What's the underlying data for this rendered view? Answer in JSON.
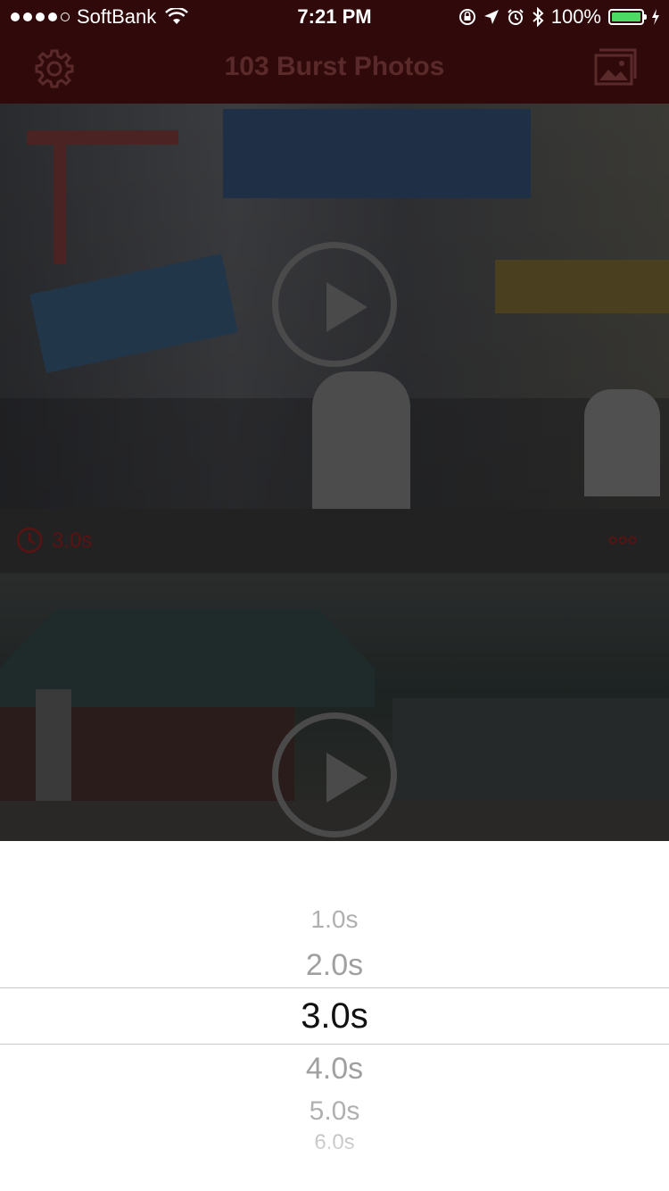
{
  "status_bar": {
    "carrier": "SoftBank",
    "time": "7:21 PM",
    "battery": "100%",
    "signal_bars": 4,
    "battery_color": "#4cd964"
  },
  "nav": {
    "title": "103 Burst Photos",
    "left_icon": "gear-icon",
    "right_icon": "photos-icon",
    "title_color": "#5a2a2a"
  },
  "cells": [
    {
      "duration": "3.0s",
      "clock_icon": "clock-icon",
      "more_icon": "more-icon"
    }
  ],
  "picker": {
    "options": [
      "1.0s",
      "2.0s",
      "3.0s",
      "4.0s",
      "5.0s",
      "6.0s"
    ],
    "selected": "3.0s"
  },
  "accent_color": "#5a1212"
}
